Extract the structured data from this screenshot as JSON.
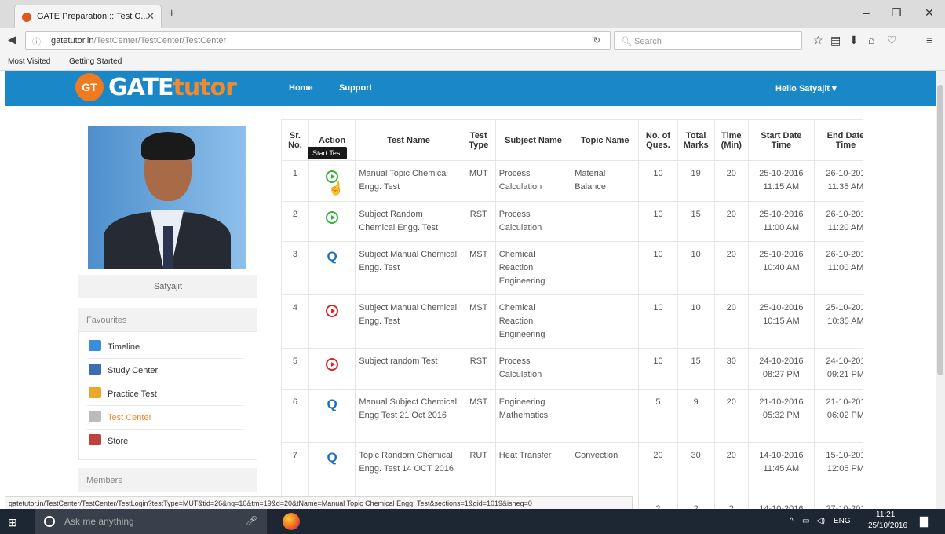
{
  "browser": {
    "tab_title": "GATE Preparation :: Test C...",
    "url_domain": "gatetutor.in",
    "url_path": "/TestCenter/TestCenter/TestCenter",
    "search_placeholder": "Search",
    "bookmarks": [
      "Most Visited",
      "Getting Started"
    ]
  },
  "site": {
    "logo_badge": "GT",
    "logo_main": "GATE",
    "logo_sub": "tutor",
    "nav": [
      "Home",
      "Support"
    ],
    "user_menu": "Hello Satyajit"
  },
  "sidebar": {
    "profile_name": "Satyajit",
    "favourites_title": "Favourites",
    "items": [
      {
        "label": "Timeline",
        "color": "#3a8edb"
      },
      {
        "label": "Study Center",
        "color": "#3a6eb0"
      },
      {
        "label": "Practice Test",
        "color": "#e8a82a"
      },
      {
        "label": "Test Center",
        "color": "#bbbbbb"
      },
      {
        "label": "Store",
        "color": "#c04040"
      }
    ],
    "members_title": "Members"
  },
  "table": {
    "headers": [
      "Sr. No.",
      "Action",
      "Test Name",
      "Test Type",
      "Subject Name",
      "Topic Name",
      "No. of Ques.",
      "Total Marks",
      "Time (Min)",
      "Start Date Time",
      "End Date Time"
    ],
    "tooltip": "Start Test",
    "rows": [
      {
        "sr": "1",
        "action": "start-green",
        "name": "Manual Topic Chemical Engg. Test",
        "type": "MUT",
        "subject": "Process Calculation",
        "topic": "Material Balance",
        "ques": "10",
        "marks": "19",
        "time": "20",
        "start": "25-10-2016 11:15 AM",
        "end": "26-10-201 11:35 AM"
      },
      {
        "sr": "2",
        "action": "start-green",
        "name": "Subject Random Chemical Engg. Test",
        "type": "RST",
        "subject": "Process Calculation",
        "topic": "",
        "ques": "10",
        "marks": "15",
        "time": "20",
        "start": "25-10-2016 11:00 AM",
        "end": "26-10-201 11:20 AM"
      },
      {
        "sr": "3",
        "action": "view-blue",
        "name": "Subject Manual Chemical Engg. Test",
        "type": "MST",
        "subject": "Chemical Reaction Engineering",
        "topic": "",
        "ques": "10",
        "marks": "10",
        "time": "20",
        "start": "25-10-2016 10:40 AM",
        "end": "26-10-201 11:00 AM"
      },
      {
        "sr": "4",
        "action": "start-red",
        "name": "Subject Manual Chemical Engg. Test",
        "type": "MST",
        "subject": "Chemical Reaction Engineering",
        "topic": "",
        "ques": "10",
        "marks": "10",
        "time": "20",
        "start": "25-10-2016 10:15 AM",
        "end": "25-10-201 10:35 AM"
      },
      {
        "sr": "5",
        "action": "start-red",
        "name": "Subject random Test",
        "type": "RST",
        "subject": "Process Calculation",
        "topic": "",
        "ques": "10",
        "marks": "15",
        "time": "30",
        "start": "24-10-2016 08:27 PM",
        "end": "24-10-201 09:21 PM"
      },
      {
        "sr": "6",
        "action": "view-blue",
        "name": "Manual Subject Chemical Engg Test 21 Oct 2016",
        "type": "MST",
        "subject": "Engineering Mathematics",
        "topic": "",
        "ques": "5",
        "marks": "9",
        "time": "20",
        "start": "21-10-2016 05:32 PM",
        "end": "21-10-201 06:02 PM"
      },
      {
        "sr": "7",
        "action": "view-blue",
        "name": "Topic Random Chemical Engg. Test 14 OCT 2016",
        "type": "RUT",
        "subject": "Heat Transfer",
        "topic": "Convection",
        "ques": "20",
        "marks": "30",
        "time": "20",
        "start": "14-10-2016 11:45 AM",
        "end": "15-10-201 12:05 PM"
      },
      {
        "sr": "",
        "action": "",
        "name": "",
        "type": "",
        "subject": "",
        "topic": "",
        "ques": "2",
        "marks": "2",
        "time": "2",
        "start": "14-10-2016",
        "end": "27-10-201"
      }
    ]
  },
  "status_url": "gatetutor.in/TestCenter/TestCenter/TestLogin?testType=MUT&tid=26&nq=10&tm=19&d=20&tName=Manual Topic Chemical Engg. Test&sections=1&gid=1019&isneg=0",
  "taskbar": {
    "search": "Ask me anything",
    "lang": "ENG",
    "time": "11:21",
    "date": "25/10/2016"
  }
}
